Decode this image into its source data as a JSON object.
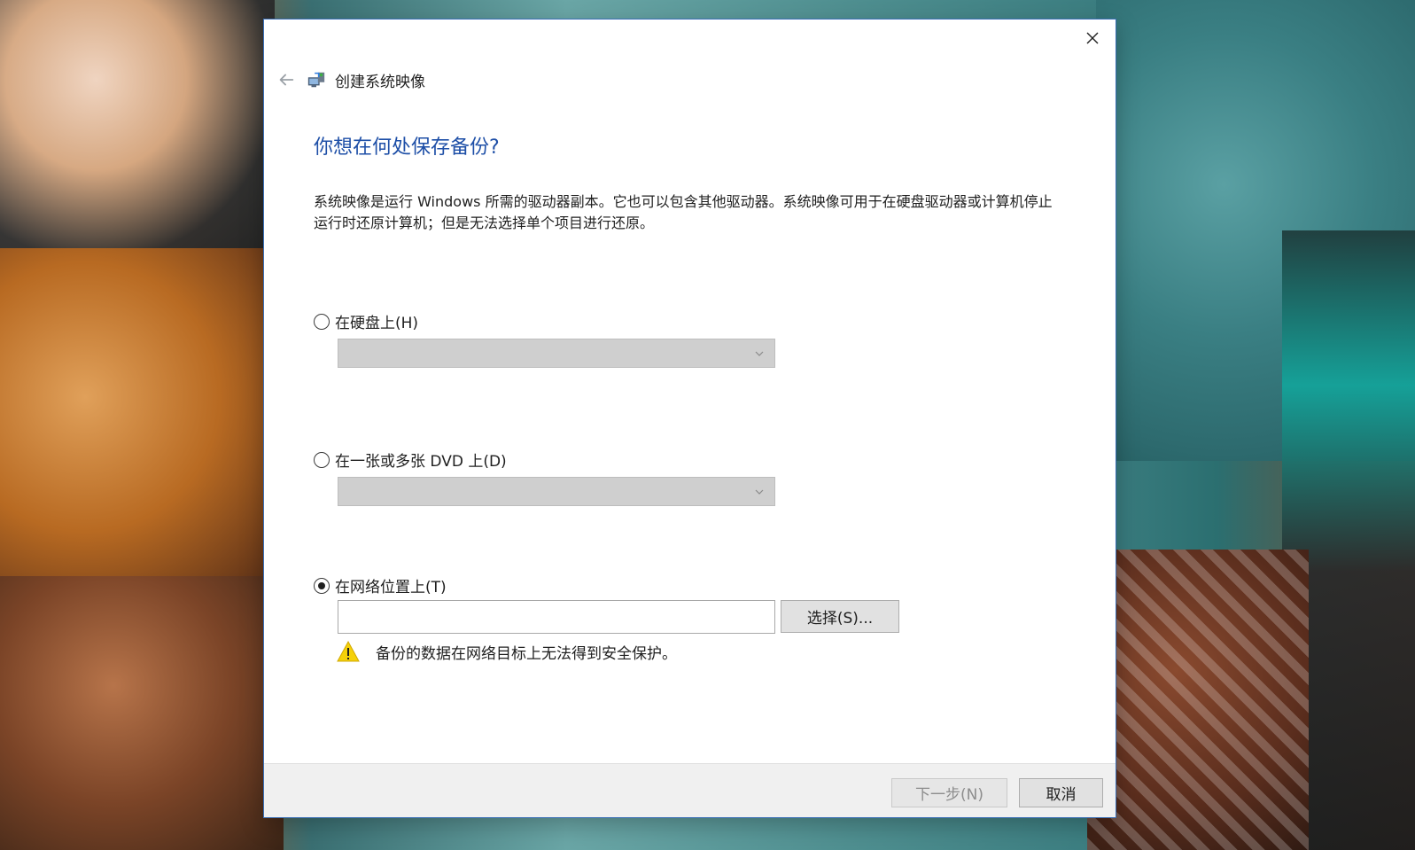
{
  "dialog": {
    "title": "创建系统映像",
    "heading": "你想在何处保存备份?",
    "description": "系统映像是运行 Windows 所需的驱动器副本。它也可以包含其他驱动器。系统映像可用于在硬盘驱动器或计算机停止运行时还原计算机；但是无法选择单个项目进行还原。",
    "options": [
      {
        "label": "在硬盘上(H)",
        "selected": false,
        "dropdown_value": ""
      },
      {
        "label": "在一张或多张 DVD 上(D)",
        "selected": false,
        "dropdown_value": ""
      },
      {
        "label": "在网络位置上(T)",
        "selected": true,
        "input_value": ""
      }
    ],
    "select_button_label": "选择(S)...",
    "warning_text": "备份的数据在网络目标上无法得到安全保护。",
    "footer": {
      "next_label": "下一步(N)",
      "cancel_label": "取消"
    }
  },
  "icons": {
    "back": "back-arrow-icon",
    "app": "system-image-icon",
    "close": "close-icon",
    "dropdown": "chevron-down-icon",
    "warning": "warning-icon"
  },
  "colors": {
    "heading": "#1e4fa7",
    "dialog_border": "#3b6fb6",
    "warning_yellow": "#f5d10a"
  }
}
